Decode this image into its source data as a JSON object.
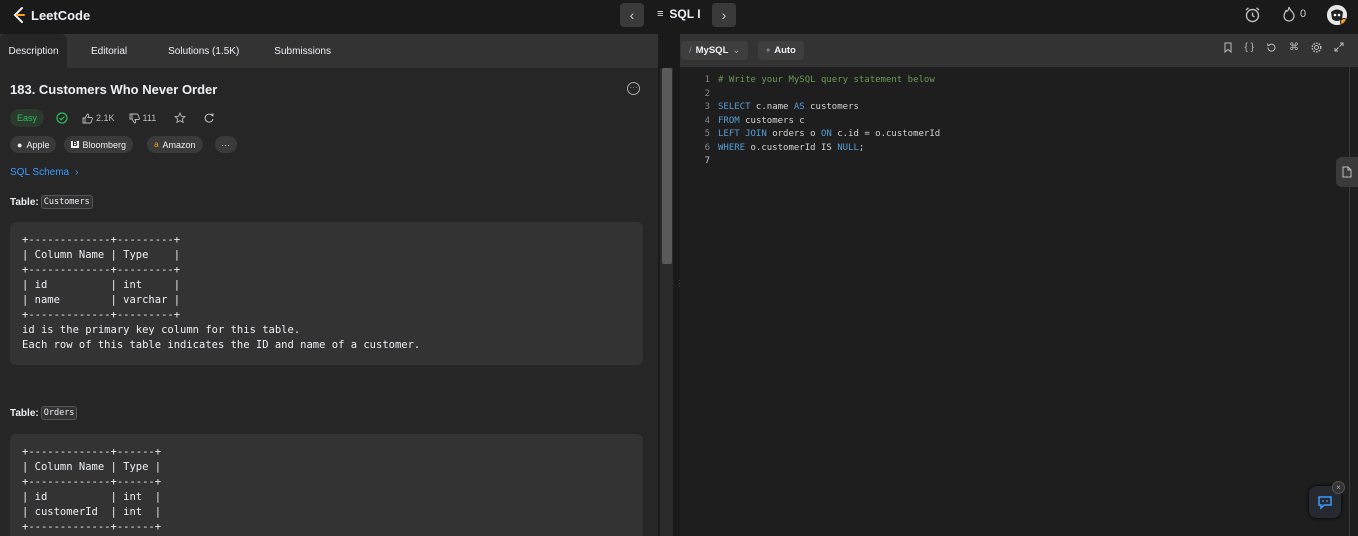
{
  "topbar": {
    "logo_text": "LeetCode",
    "problem_list_label": "SQL I",
    "streak_count": "0"
  },
  "left_tabs": [
    "Description",
    "Editorial",
    "Solutions (1.5K)",
    "Submissions"
  ],
  "problem": {
    "title": "183. Customers Who Never Order",
    "difficulty": "Easy",
    "likes": "2.1K",
    "dislikes": "111",
    "companies": [
      "Apple",
      "Bloomberg",
      "Amazon"
    ],
    "more_label": "···",
    "schema_link": "SQL Schema",
    "table1_label": "Table:",
    "table1_name": "Customers",
    "table1_block": "+-------------+---------+\n| Column Name | Type    |\n+-------------+---------+\n| id          | int     |\n| name        | varchar |\n+-------------+---------+\nid is the primary key column for this table.\nEach row of this table indicates the ID and name of a customer.",
    "table2_label": "Table:",
    "table2_name": "Orders",
    "table2_block": "+-------------+------+\n| Column Name | Type |\n+-------------+------+\n| id          | int  |\n| customerId  | int  |\n+-------------+------+"
  },
  "editor_header": {
    "language": "MySQL",
    "mode": "Auto"
  },
  "code": {
    "line_numbers": [
      "1",
      "2",
      "3",
      "4",
      "5",
      "6",
      "7"
    ],
    "l1": "# Write your MySQL query statement below",
    "l3a": "SELECT",
    "l3b": " c.name ",
    "l3c": "AS",
    "l3d": " customers",
    "l4a": "FROM",
    "l4b": " customers c",
    "l5a": "LEFT JOIN",
    "l5b": " orders o ",
    "l5c": "ON",
    "l5d": " c.id = o.customerId",
    "l6a": "WHERE",
    "l6b": " o.customerId IS ",
    "l6c": "NULL",
    "l6d": ";"
  },
  "colors": {
    "accent": "#ffa116",
    "easy": "#2cbb5d",
    "link": "#3b9bff"
  }
}
